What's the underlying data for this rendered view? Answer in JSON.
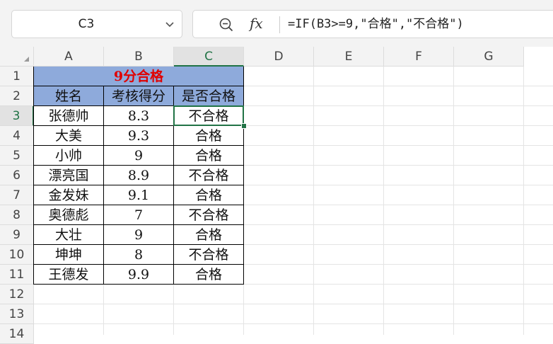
{
  "namebox": {
    "value": "C3"
  },
  "formula_bar": {
    "fx_label": "fx",
    "formula": "=IF(B3>=9,\"合格\",\"不合格\")"
  },
  "columns": [
    "A",
    "B",
    "C",
    "D",
    "E",
    "F",
    "G"
  ],
  "selected_column": "C",
  "rows": [
    "1",
    "2",
    "3",
    "4",
    "5",
    "6",
    "7",
    "8",
    "9",
    "10",
    "11",
    "12",
    "13",
    "14"
  ],
  "selected_row": "3",
  "sheet": {
    "title": "9分合格",
    "headers": [
      "姓名",
      "考核得分",
      "是否合格"
    ],
    "data": [
      [
        "张德帅",
        "8.3",
        "不合格"
      ],
      [
        "大美",
        "9.3",
        "合格"
      ],
      [
        "小帅",
        "9",
        "合格"
      ],
      [
        "漂亮国",
        "8.9",
        "不合格"
      ],
      [
        "金发妹",
        "9.1",
        "合格"
      ],
      [
        "奥德彪",
        "7",
        "不合格"
      ],
      [
        "大壮",
        "9",
        "合格"
      ],
      [
        "坤坤",
        "8",
        "不合格"
      ],
      [
        "王德发",
        "9.9",
        "合格"
      ]
    ]
  },
  "colors": {
    "header_fill": "#8eaadb",
    "title_text": "#e00000",
    "selection": "#217346"
  }
}
